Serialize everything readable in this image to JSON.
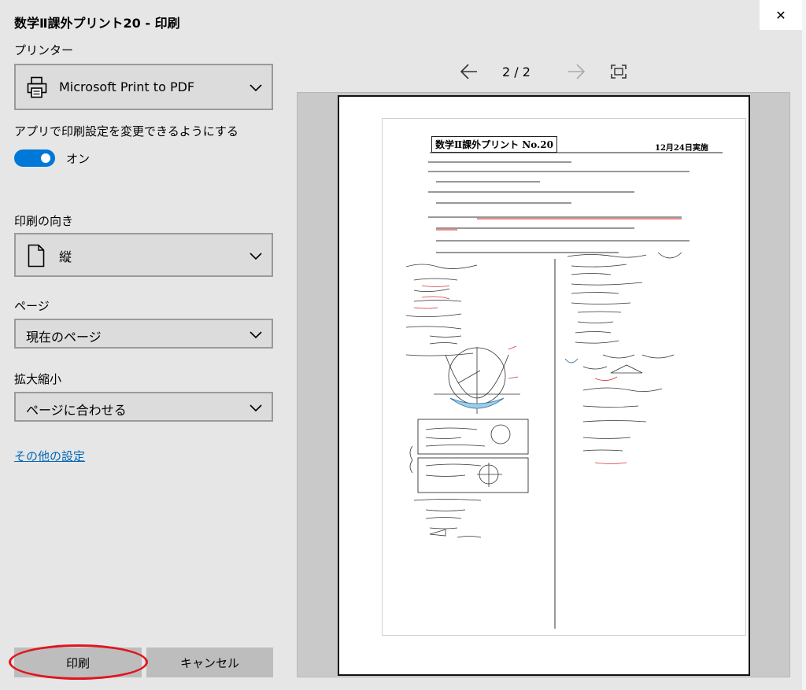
{
  "dialog": {
    "title": "数学Ⅱ課外プリント20 - 印刷",
    "close_glyph": "✕"
  },
  "printer": {
    "label": "プリンター",
    "selected": "Microsoft Print to PDF",
    "icon": "printer-icon"
  },
  "app_settings": {
    "label": "アプリで印刷設定を変更できるようにする",
    "toggle_state": "オン",
    "toggle_on": true
  },
  "orientation": {
    "label": "印刷の向き",
    "selected": "縦",
    "icon": "portrait-page-icon"
  },
  "pages": {
    "label": "ページ",
    "selected": "現在のページ"
  },
  "scale": {
    "label": "拡大縮小",
    "selected": "ページに合わせる"
  },
  "more_settings": "その他の設定",
  "buttons": {
    "print": "印刷",
    "cancel": "キャンセル"
  },
  "preview": {
    "page_indicator": "2 / 2",
    "worksheet_title": "数学Ⅱ課外プリント No.20",
    "worksheet_date": "12月24日実施"
  },
  "colors": {
    "accent": "#0078d7",
    "link": "#0067b8",
    "highlight": "#e0151f"
  }
}
